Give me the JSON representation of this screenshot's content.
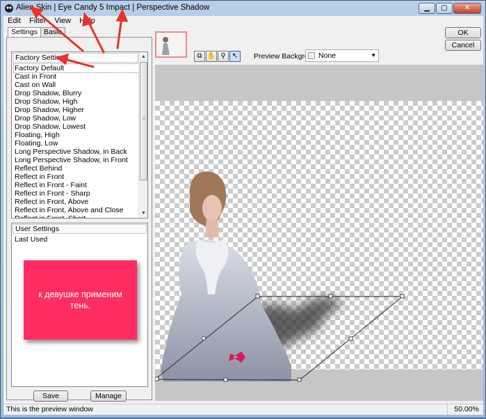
{
  "window": {
    "title": "Alien Skin | Eye Candy 5 Impact | Perspective Shadow",
    "controls": {
      "minimize": "▁",
      "maximize": "▢",
      "close": "✕"
    }
  },
  "menu": [
    "Edit",
    "Filter",
    "View",
    "Help"
  ],
  "tabs": [
    "Settings",
    "Basic"
  ],
  "factory_settings": {
    "header": "Factory Settings",
    "items": [
      "Factory Default",
      "Cast in Front",
      "Cast on Wall",
      "Drop Shadow, Blurry",
      "Drop Shadow, High",
      "Drop Shadow, Higher",
      "Drop Shadow, Low",
      "Drop Shadow, Lowest",
      "Floating, High",
      "Floating, Low",
      "Long Perspective Shadow, in Back",
      "Long Perspective Shadow, in Front",
      "Reflect Behind",
      "Reflect in Front",
      "Reflect in Front - Faint",
      "Reflect in Front - Sharp",
      "Reflect in Front, Above",
      "Reflect in Front, Above and Close",
      "Reflect in Front, Short"
    ],
    "selected_index": 0
  },
  "user_settings": {
    "header": "User Settings",
    "items": [
      "Last Used"
    ]
  },
  "note_text": "к девушке применим тень.",
  "buttons": {
    "save": "Save",
    "manage": "Manage",
    "ok": "OK",
    "cancel": "Cancel"
  },
  "preview": {
    "background_label": "Preview Background:",
    "background_value": "None"
  },
  "status": {
    "text": "This is the preview window",
    "zoom": "50.00%"
  },
  "colors": {
    "annotation_arrow": "#e8322a",
    "note_background": "#ff2d62"
  }
}
